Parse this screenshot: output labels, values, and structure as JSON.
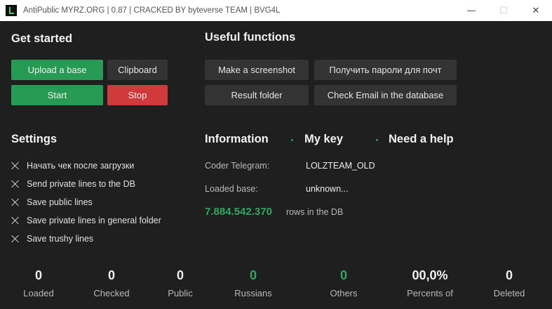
{
  "window": {
    "title": "AntiPublic MYRZ.ORG | 0.87 | CRACKED BY byteverse TEAM | BVG4L",
    "minimize": "—",
    "maximize": "☐",
    "close": "✕"
  },
  "get_started": {
    "title": "Get started",
    "upload_label": "Upload a base",
    "clipboard_label": "Clipboard",
    "start_label": "Start",
    "stop_label": "Stop"
  },
  "useful_functions": {
    "title": "Useful functions",
    "screenshot_label": "Make a screenshot",
    "passwords_label": "Получить пароли для почт",
    "result_folder_label": "Result folder",
    "check_email_label": "Check Email in the database"
  },
  "settings": {
    "title": "Settings",
    "items": [
      {
        "label": "Начать чек после загрузки"
      },
      {
        "label": "Send private lines to the DB"
      },
      {
        "label": "Save public lines"
      },
      {
        "label": "Save private lines in general folder"
      },
      {
        "label": "Save trushy lines"
      }
    ]
  },
  "information": {
    "tabs": {
      "information": "Information",
      "my_key": "My key",
      "need_help": "Need a help"
    },
    "coder_label": "Coder Telegram:",
    "coder_value": "LOLZTEAM_OLD",
    "base_label": "Loaded base:",
    "base_value": "unknown...",
    "rows_count": "7.884.542.370",
    "rows_label": "rows in the DB"
  },
  "stats": [
    {
      "value": "0",
      "label": "Loaded"
    },
    {
      "value": "0",
      "label": "Checked"
    },
    {
      "value": "0",
      "label": "Public"
    },
    {
      "value": "0",
      "label": "Russians"
    },
    {
      "value": "0",
      "label": "Others"
    },
    {
      "value": "00,0%",
      "label": "Percents of"
    },
    {
      "value": "0",
      "label": "Deleted"
    }
  ],
  "colors": {
    "accent_green": "#279b53",
    "stop_red": "#d13a3a",
    "background": "#1f1f1f"
  }
}
